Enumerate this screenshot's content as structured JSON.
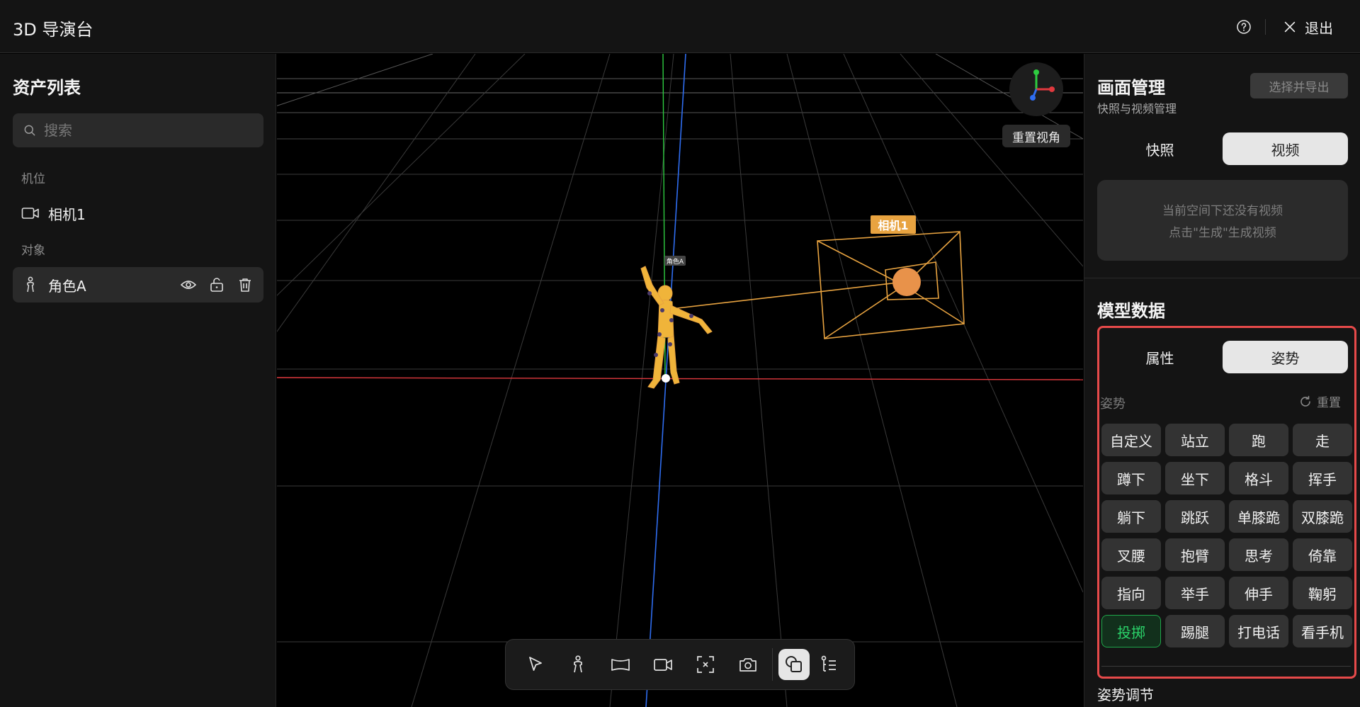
{
  "header": {
    "title": "3D 导演台",
    "exit_label": "退出"
  },
  "assets": {
    "title": "资产列表",
    "search_placeholder": "搜索",
    "camera_section": "机位",
    "camera_item": "相机1",
    "object_section": "对象",
    "object_item": "角色A"
  },
  "viewport": {
    "reset_view": "重置视角",
    "camera_tag": "相机1",
    "character_tag": "角色A",
    "colors": {
      "x_axis": "#e0393e",
      "y_axis": "#2ecc40",
      "z_axis": "#2f6df0",
      "camera_frustum": "#e8a340"
    }
  },
  "toolbar": {
    "tools": [
      "select-icon",
      "character-icon",
      "scene-icon",
      "camera-icon",
      "focus-icon",
      "snapshot-icon",
      "overlap-icon",
      "list-icon"
    ]
  },
  "frame_manager": {
    "title": "画面管理",
    "subtitle": "快照与视频管理",
    "export_label": "选择并导出",
    "tabs": [
      "快照",
      "视频"
    ],
    "active_tab": "视频",
    "empty_line1": "当前空间下还没有视频",
    "empty_line2": "点击\"生成\"生成视频"
  },
  "model_data": {
    "title": "模型数据",
    "tabs": [
      "属性",
      "姿势"
    ],
    "active_tab": "姿势",
    "pose_label": "姿势",
    "reset_label": "重置",
    "poses": [
      "自定义",
      "站立",
      "跑",
      "走",
      "蹲下",
      "坐下",
      "格斗",
      "挥手",
      "躺下",
      "跳跃",
      "单膝跪",
      "双膝跪",
      "叉腰",
      "抱臂",
      "思考",
      "倚靠",
      "指向",
      "举手",
      "伸手",
      "鞠躬",
      "投掷",
      "踢腿",
      "打电话",
      "看手机"
    ],
    "active_pose": "投掷",
    "adjust_title": "姿势调节",
    "accent_color": "#1fa64a"
  }
}
